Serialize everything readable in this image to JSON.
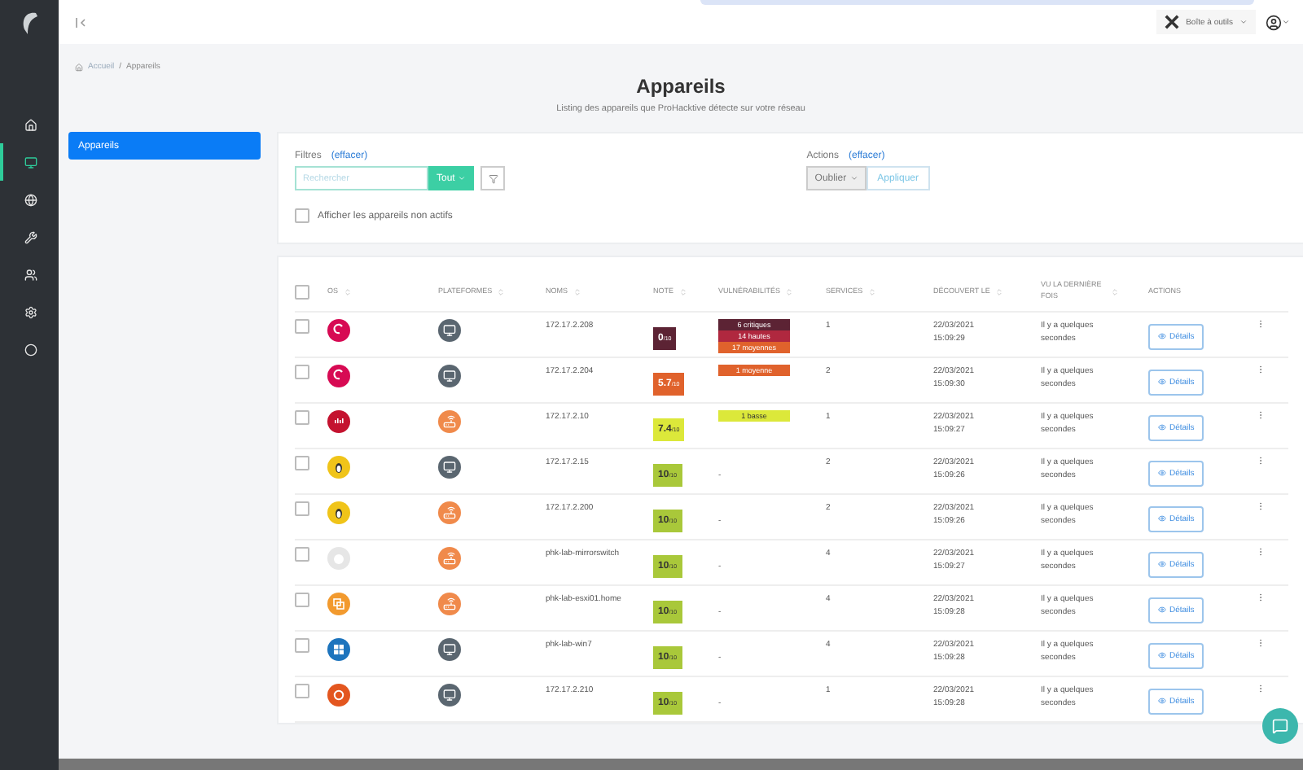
{
  "sidebar": {
    "items": [
      {
        "kind": "home",
        "selected": false
      },
      {
        "kind": "devices",
        "selected": true
      },
      {
        "kind": "globe",
        "selected": false
      },
      {
        "kind": "wrench",
        "selected": false
      },
      {
        "kind": "users",
        "selected": false
      },
      {
        "kind": "settings",
        "selected": false
      },
      {
        "kind": "circle",
        "selected": false
      }
    ]
  },
  "topbar": {
    "toolbox": "Boîte à outils"
  },
  "breadcrumb": [
    "Accueil",
    "/",
    "Appareils"
  ],
  "header": {
    "title": "Appareils",
    "subtitle": "Listing des appareils que ProHacktive détecte sur votre réseau"
  },
  "nav": [
    {
      "label": "Appareils",
      "selected": true
    }
  ],
  "filters": {
    "label": "Filtres",
    "clear": "(effacer)",
    "placeholder": "Rechercher",
    "scope": "Tout",
    "inactive_label": "Afficher les appareils non actifs",
    "inactive_checked": false
  },
  "actions": {
    "label": "Actions",
    "clear": "(effacer)",
    "select": "Oublier",
    "apply": "Appliquer"
  },
  "table": {
    "select_all_checked": false,
    "columns": [
      {
        "label": "OS",
        "sortable": true
      },
      {
        "label": "PLATEFORMES",
        "sortable": true
      },
      {
        "label": "NOMS",
        "sortable": true
      },
      {
        "label": "NOTE",
        "sortable": true
      },
      {
        "label": "VULNÉRABILITÉS",
        "sortable": true
      },
      {
        "label": "SERVICES",
        "sortable": true
      },
      {
        "label": "DÉCOUVERT LE",
        "sortable": true
      },
      {
        "label": "VU LA DERNIÈRE FOIS",
        "sortable": true
      },
      {
        "label": "ACTIONS",
        "sortable": false
      }
    ],
    "rows": [
      {
        "checked": false,
        "os": {
          "kind": "debian"
        },
        "platform": {
          "kind": "computer"
        },
        "name": "172.17.2.208",
        "score": {
          "value": "0",
          "max": "/10",
          "color": "#5c2334"
        },
        "vulnerabilities": [
          {
            "label": "6 critiques",
            "color": "#5c2334"
          },
          {
            "label": "14 hautes",
            "color": "#b0283f"
          },
          {
            "label": "17 moyennes",
            "color": "#e0622c"
          }
        ],
        "services": "1",
        "date": "22/03/2021",
        "time": "15:09:29",
        "seen": "Il y a quelques secondes",
        "details": "Détails"
      },
      {
        "checked": false,
        "os": {
          "kind": "debian"
        },
        "platform": {
          "kind": "computer"
        },
        "name": "172.17.2.204",
        "score": {
          "value": "5.7",
          "max": "/10",
          "color": "#e0622c"
        },
        "vulnerabilities": [
          {
            "label": "1 moyenne",
            "color": "#e0622c"
          }
        ],
        "services": "2",
        "date": "22/03/2021",
        "time": "15:09:30",
        "seen": "Il y a quelques secondes",
        "details": "Détails"
      },
      {
        "checked": false,
        "os": {
          "kind": "cisco"
        },
        "platform": {
          "kind": "router"
        },
        "name": "172.17.2.10",
        "score": {
          "value": "7.4",
          "max": "/10",
          "color": "#dce83a"
        },
        "vulnerabilities": [
          {
            "label": "1 basse",
            "color": "#dce83a"
          }
        ],
        "services": "1",
        "date": "22/03/2021",
        "time": "15:09:27",
        "seen": "Il y a quelques secondes",
        "details": "Détails"
      },
      {
        "checked": false,
        "os": {
          "kind": "linux"
        },
        "platform": {
          "kind": "computer"
        },
        "name": "172.17.2.15",
        "score": {
          "value": "10",
          "max": "/10",
          "color": "#a9c83a"
        },
        "vulnerabilities_text": "-",
        "services": "2",
        "date": "22/03/2021",
        "time": "15:09:26",
        "seen": "Il y a quelques secondes",
        "details": "Détails"
      },
      {
        "checked": false,
        "os": {
          "kind": "linux"
        },
        "platform": {
          "kind": "router"
        },
        "name": "172.17.2.200",
        "score": {
          "value": "10",
          "max": "/10",
          "color": "#a9c83a"
        },
        "vulnerabilities_text": "-",
        "services": "2",
        "date": "22/03/2021",
        "time": "15:09:26",
        "seen": "Il y a quelques secondes",
        "details": "Détails"
      },
      {
        "checked": false,
        "os": {
          "kind": "apple"
        },
        "platform": {
          "kind": "router"
        },
        "name": "phk-lab-mirrorswitch",
        "score": {
          "value": "10",
          "max": "/10",
          "color": "#a9c83a"
        },
        "vulnerabilities_text": "-",
        "services": "4",
        "date": "22/03/2021",
        "time": "15:09:27",
        "seen": "Il y a quelques secondes",
        "details": "Détails"
      },
      {
        "checked": false,
        "os": {
          "kind": "vmware"
        },
        "platform": {
          "kind": "router"
        },
        "name": "phk-lab-esxi01.home",
        "score": {
          "value": "10",
          "max": "/10",
          "color": "#a9c83a"
        },
        "vulnerabilities_text": "-",
        "services": "4",
        "date": "22/03/2021",
        "time": "15:09:28",
        "seen": "Il y a quelques secondes",
        "details": "Détails"
      },
      {
        "checked": false,
        "os": {
          "kind": "windows"
        },
        "platform": {
          "kind": "computer"
        },
        "name": "phk-lab-win7",
        "score": {
          "value": "10",
          "max": "/10",
          "color": "#a9c83a"
        },
        "vulnerabilities_text": "-",
        "services": "4",
        "date": "22/03/2021",
        "time": "15:09:28",
        "seen": "Il y a quelques secondes",
        "details": "Détails"
      },
      {
        "checked": false,
        "os": {
          "kind": "ubuntu"
        },
        "platform": {
          "kind": "computer"
        },
        "name": "172.17.2.210",
        "score": {
          "value": "10",
          "max": "/10",
          "color": "#a9c83a"
        },
        "vulnerabilities_text": "-",
        "services": "1",
        "date": "22/03/2021",
        "time": "15:09:28",
        "seen": "Il y a quelques secondes",
        "details": "Détails"
      }
    ]
  }
}
